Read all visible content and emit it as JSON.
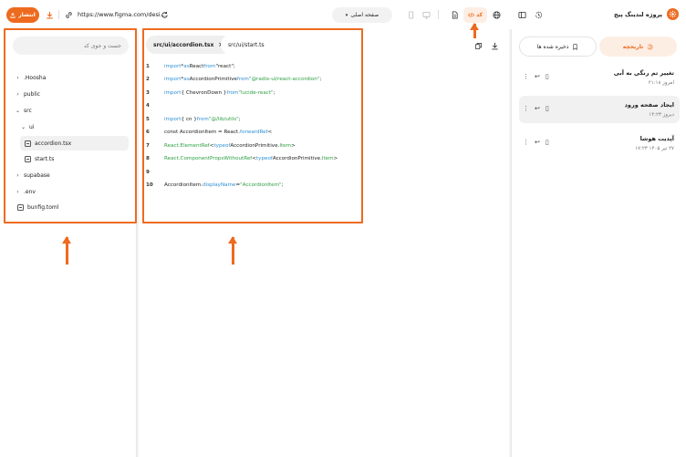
{
  "toolbar": {
    "publish_label": "انتشار",
    "url": "https://www.figma.com/desi...",
    "page_select": "صفحه اصلی",
    "code_label": "کد"
  },
  "project": {
    "title": "پروژه لندینگ پیج"
  },
  "file_tree": {
    "search_placeholder": "جست و جوی کد",
    "items": [
      {
        "label": ".Hoosha",
        "type": "folder",
        "expanded": false
      },
      {
        "label": "public",
        "type": "folder",
        "expanded": false
      },
      {
        "label": "src",
        "type": "folder",
        "expanded": true
      },
      {
        "label": "ui",
        "type": "folder",
        "expanded": true
      },
      {
        "label": "accordion.tsx",
        "type": "file",
        "selected": true
      },
      {
        "label": "start.ts",
        "type": "file"
      },
      {
        "label": "supabase",
        "type": "folder",
        "expanded": false
      },
      {
        "label": ".env",
        "type": "folder",
        "expanded": false
      },
      {
        "label": "bunfig.toml",
        "type": "file"
      }
    ]
  },
  "editor": {
    "tabs": [
      {
        "label": "src/ui/accordion.tsx",
        "active": true
      },
      {
        "label": "src/ui/start.ts",
        "active": false
      }
    ],
    "lines": [
      {
        "n": "1",
        "tokens": [
          [
            "kw",
            "import"
          ],
          [
            "id",
            " * "
          ],
          [
            "kw",
            "as"
          ],
          [
            "id",
            " React "
          ],
          [
            "kw",
            "from"
          ],
          [
            "id",
            " \"react\";"
          ]
        ]
      },
      {
        "n": "2",
        "tokens": [
          [
            "kw",
            "import"
          ],
          [
            "id",
            " * "
          ],
          [
            "kw",
            "as"
          ],
          [
            "id",
            " AccordionPrimitive "
          ],
          [
            "kw",
            "from"
          ],
          [
            "str",
            " \"@radix-ui/react-accordion\""
          ],
          [
            "id",
            ";"
          ]
        ]
      },
      {
        "n": "3",
        "tokens": [
          [
            "kw",
            "import"
          ],
          [
            "id",
            " { ChevronDown } "
          ],
          [
            "kw",
            "from"
          ],
          [
            "str",
            " \"lucide-react\""
          ],
          [
            "id",
            ";"
          ]
        ]
      },
      {
        "n": "4",
        "tokens": []
      },
      {
        "n": "5",
        "tokens": [
          [
            "kw",
            "import"
          ],
          [
            "id",
            " { cn } "
          ],
          [
            "kw",
            "from"
          ],
          [
            "str",
            " \"@/lib/utils\""
          ],
          [
            "id",
            ";"
          ]
        ]
      },
      {
        "n": "6",
        "tokens": [
          [
            "id",
            "const AccordionItem = React."
          ],
          [
            "kw",
            "forwardRef"
          ],
          [
            "id",
            "<"
          ]
        ]
      },
      {
        "n": "7",
        "tokens": [
          [
            "green",
            "React.ElementRef"
          ],
          [
            "id",
            "<"
          ],
          [
            "kw",
            "typeof"
          ],
          [
            "id",
            " AccordionPrimitive."
          ],
          [
            "green",
            "Item"
          ],
          [
            "id",
            ">"
          ]
        ]
      },
      {
        "n": "8",
        "tokens": [
          [
            "green",
            "React.ComponentPropsWithoutRef"
          ],
          [
            "id",
            "<"
          ],
          [
            "kw",
            "typeof"
          ],
          [
            "id",
            " AccordionPrimitive."
          ],
          [
            "green",
            "Item"
          ],
          [
            "id",
            ">"
          ]
        ]
      },
      {
        "n": "9",
        "tokens": []
      },
      {
        "n": "10",
        "tokens": [
          [
            "id",
            "AccordionItem."
          ],
          [
            "kw",
            "displayName"
          ],
          [
            "id",
            " = "
          ],
          [
            "str",
            "\"AccordionItem\""
          ],
          [
            "id",
            ";"
          ]
        ]
      }
    ]
  },
  "history_panel": {
    "tab_history": "تاریخچه",
    "tab_saved": "ذخیره شده ها",
    "items": [
      {
        "title": "تغییر تم رنگی به آبی",
        "time": "امروز ۲۱:۱۸",
        "selected": false
      },
      {
        "title": "ایجاد صفحه ورود",
        "time": "دیروز ۱۴:۲۳",
        "selected": true
      },
      {
        "title": "آپدیت هوشا",
        "time": "۲۷ تیر ۱۴۰۵ ۱۷:۲۳",
        "selected": false
      }
    ]
  },
  "colors": {
    "accent": "#ee6a1f",
    "accent_soft": "#fdeee4"
  }
}
